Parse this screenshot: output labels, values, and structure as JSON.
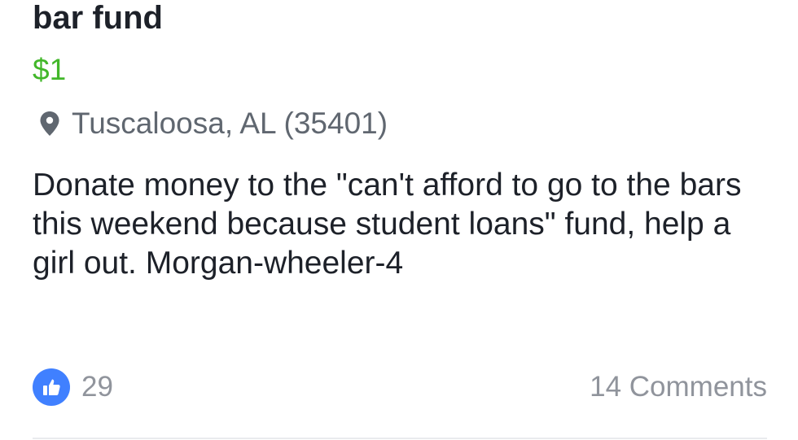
{
  "listing": {
    "title": "bar fund",
    "price": "$1",
    "location_icon": "map-pin-icon",
    "location": "Tuscaloosa, AL (35401)",
    "description": "Donate money to the \"can't afford to go to the bars this weekend because student loans\" fund, help a girl out. Morgan-wheeler-4"
  },
  "reactions": {
    "like_icon": "thumbs-up-icon",
    "like_count": "29",
    "comments_label": "14 Comments"
  },
  "colors": {
    "price": "#42b72a",
    "like_badge": "#4080ff",
    "secondary_text": "#90949c",
    "primary_text": "#1d2129"
  }
}
